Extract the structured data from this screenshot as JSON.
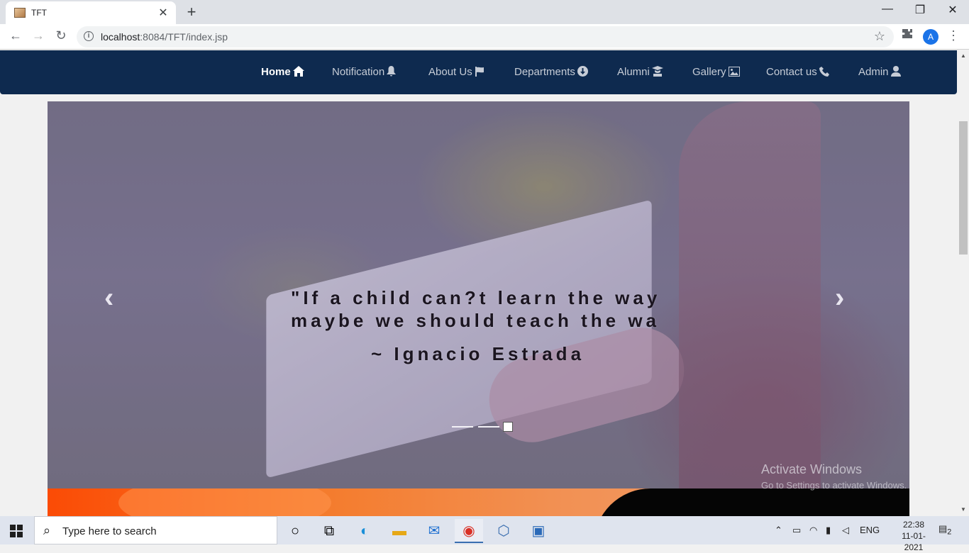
{
  "browser": {
    "tab_title": "TFT",
    "url_host": "localhost",
    "url_rest": ":8084/TFT/index.jsp",
    "profile_initial": "A"
  },
  "nav": {
    "items": [
      {
        "label": "Home",
        "icon": "home-icon",
        "active": true
      },
      {
        "label": "Notification",
        "icon": "bell-icon",
        "active": false
      },
      {
        "label": "About Us",
        "icon": "flag-icon",
        "active": false
      },
      {
        "label": "Departments",
        "icon": "arrow-circle-down-icon",
        "active": false
      },
      {
        "label": "Alumni",
        "icon": "graduate-icon",
        "active": false
      },
      {
        "label": "Gallery",
        "icon": "image-icon",
        "active": false
      },
      {
        "label": "Contact us",
        "icon": "phone-icon",
        "active": false
      },
      {
        "label": "Admin",
        "icon": "user-icon",
        "active": false
      }
    ]
  },
  "carousel": {
    "quote_line1": "\"If a child can?t learn the way",
    "quote_line2": "maybe we should teach the wa",
    "author": "~ Ignacio Estrada",
    "slide_count": 3,
    "active_slide": 3
  },
  "watermark": {
    "title": "Activate Windows",
    "subtitle": "Go to Settings to activate Windows."
  },
  "taskbar": {
    "search_placeholder": "Type here to search",
    "language": "ENG",
    "time": "22:38",
    "date": "11-01-2021",
    "notification_count": "2"
  },
  "colors": {
    "navbar_bg": "#0e2a4f",
    "nav_text": "#c6ccd6",
    "orange": "#fb4b05"
  }
}
